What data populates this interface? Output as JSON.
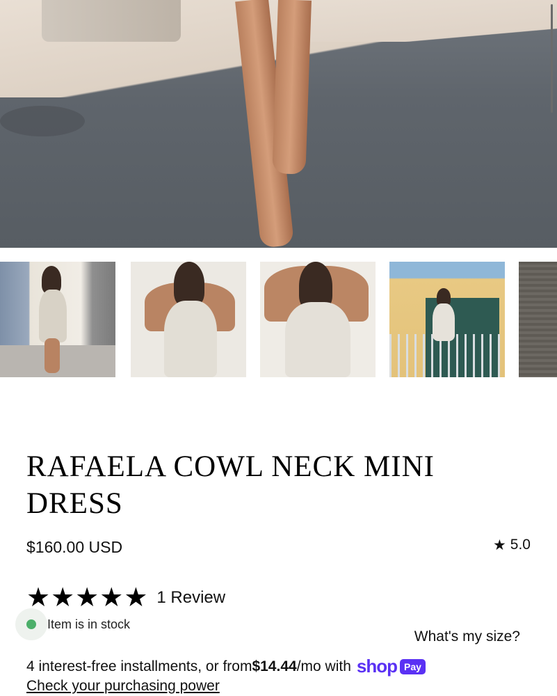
{
  "product": {
    "title": "RAFAELA COWL NECK MINI DRESS",
    "price": "$160.00 USD",
    "average_rating": "5.0",
    "review_stars": 5,
    "review_count_label": "1 Review",
    "stock_status": "Item is in stock",
    "size_link": "What's my size?"
  },
  "installments": {
    "prefix": "4 interest-free installments, or from ",
    "amount": "$14.44",
    "suffix": "/mo with",
    "brand_wordmark": "shop",
    "brand_badge": "Pay",
    "power_link": "Check your purchasing power"
  },
  "gallery": {
    "thumbnails": [
      "thumbnail 1",
      "thumbnail 2",
      "thumbnail 3",
      "thumbnail 4",
      "thumbnail 5"
    ],
    "active_index": 0
  },
  "colors": {
    "stock_dot": "#4caf6a",
    "shop_pay": "#5a31f4"
  },
  "icons": {
    "rating_star": "star-icon",
    "stock": "in-stock-dot-icon"
  }
}
